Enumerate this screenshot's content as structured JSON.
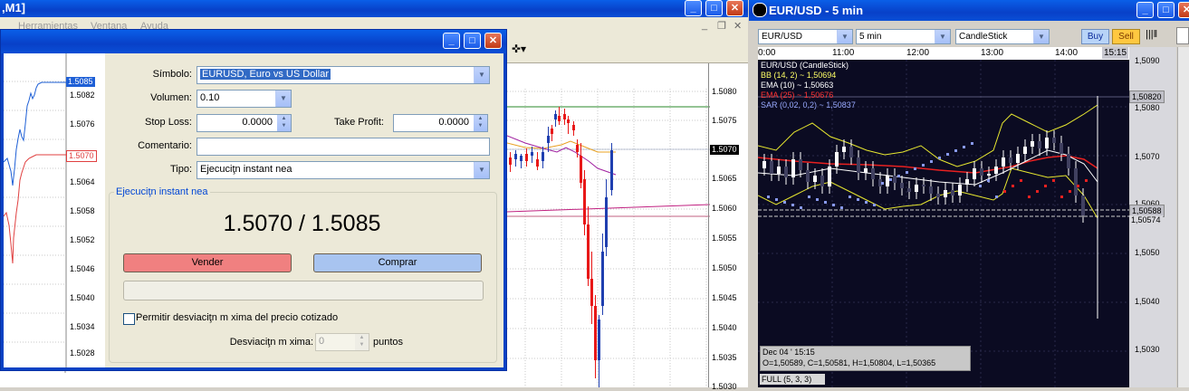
{
  "mt4": {
    "title": ",M1]",
    "menu": [
      "Herramientas",
      "Ventana",
      "Ayuda"
    ],
    "left_axis": [
      "1.5085",
      "1.5082",
      "1.5076",
      "1.5070",
      "1.5064",
      "1.5058",
      "1.5052",
      "1.5046",
      "1.5040",
      "1.5034",
      "1.5028"
    ],
    "left_ask_label": "1.5085",
    "left_bid_label": "1.5070",
    "right_axis": [
      "1.5080",
      "1.5075",
      "1.5065",
      "1.5060",
      "1.5055",
      "1.5050",
      "1.5045",
      "1.5040",
      "1.5035",
      "1.5030"
    ],
    "right_price_label": "1.5070"
  },
  "dialog": {
    "symbol_label": "Símbolo:",
    "symbol_value": "EURUSD, Euro vs US Dollar",
    "volume_label": "Volumen:",
    "volume_value": "0.10",
    "stoploss_label": "Stop Loss:",
    "stoploss_value": "0.0000",
    "takeprofit_label": "Take Profit:",
    "takeprofit_value": "0.0000",
    "comment_label": "Comentario:",
    "comment_value": "",
    "type_label": "Tipo:",
    "type_value": "Ejecuciţn instant nea",
    "group_title": "Ejecuciţn instant nea",
    "quote": "1.5070 / 1.5085",
    "sell_label": "Vender",
    "buy_label": "Comprar",
    "deviation_check_label": "Permitir desviaciţn m xima del precio cotizado",
    "deviation_label": "Desviaciţn m xima:",
    "deviation_value": "0",
    "deviation_unit": "puntos"
  },
  "right_window": {
    "title": "EUR/USD - 5 min",
    "symbol": "EUR/USD",
    "timeframe": "5 min",
    "chart_type": "CandleStick",
    "buy_label": "Buy",
    "sell_label": "Sell",
    "time_labels": [
      "0:00",
      "11:00",
      "12:00",
      "13:00",
      "14:00",
      "15:15"
    ],
    "axis_labels": [
      "1,5080",
      "1,5070",
      "1,5050",
      "1,5040",
      "1,5030",
      "1,5060"
    ],
    "axis_top_cut": "1,5090",
    "last_high_label": "1,50820",
    "last_price_label": "1,50588",
    "last_low_label": "1,50574",
    "legend": [
      {
        "text": "EUR/USD (CandleStick)",
        "color": "#ffffff"
      },
      {
        "text": "BB (14, 2) ~ 1,50694",
        "color": "#ffff66"
      },
      {
        "text": "EMA (10) ~ 1,50663",
        "color": "#ffffff"
      },
      {
        "text": "EMA (25) ~ 1,50676",
        "color": "#ff3333"
      },
      {
        "text": "SAR (0,02, 0,2) ~ 1,50837",
        "color": "#99aaff"
      }
    ],
    "info_date": "Dec 04 ' 15:15",
    "info_ohlc": "O=1,50589, C=1,50581, H=1,50804, L=1,50365",
    "footer": "FULL (5, 3, 3)"
  },
  "colors": {
    "xp_blue": "#0842c4",
    "sell_button": "#f08080",
    "buy_button": "#a8c4f0",
    "candle_up": "#1f3fb0",
    "candle_down": "#e81818"
  }
}
